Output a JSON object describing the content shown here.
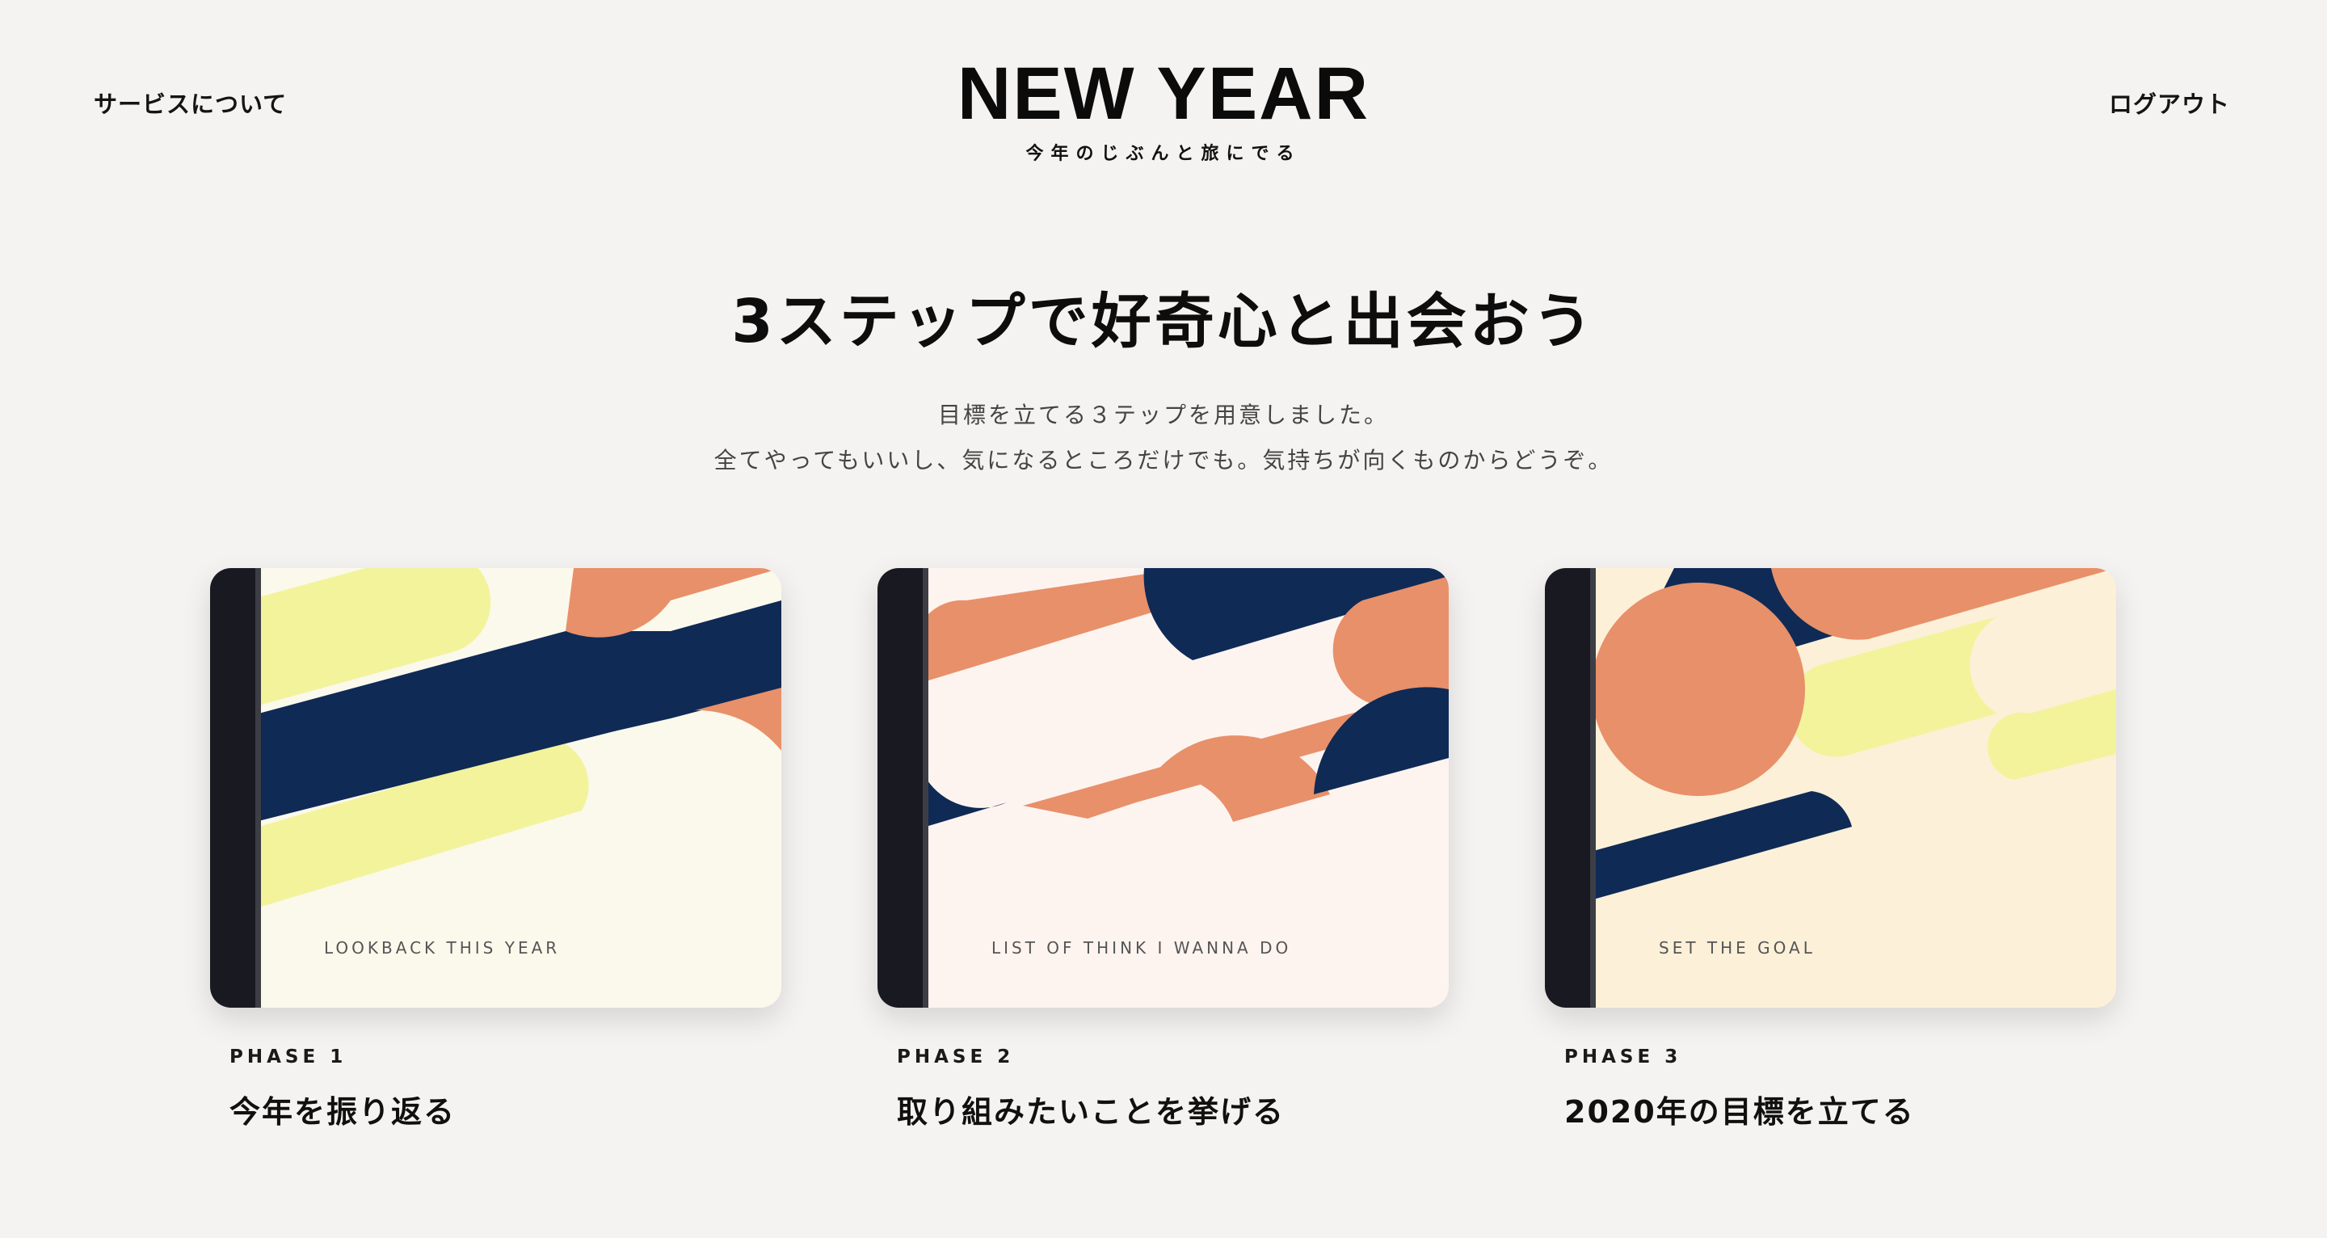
{
  "header": {
    "nav_left": "サービスについて",
    "logo_title": "NEW YEAR",
    "logo_subtitle": "今年のじぶんと旅にでる",
    "nav_right": "ログアウト"
  },
  "intro": {
    "headline": "3ステップで好奇心と出会おう",
    "description_line1": "目標を立てる３テップを用意しました。",
    "description_line2": "全てやってもいいし、気になるところだけでも。気持ちが向くものからどうぞ。"
  },
  "cards": [
    {
      "cover_label": "LOOKBACK THIS YEAR",
      "phase": "PHASE 1",
      "title": "今年を振り返る"
    },
    {
      "cover_label": "LIST OF THINK I WANNA DO",
      "phase": "PHASE 2",
      "title": "取り組みたいことを挙げる"
    },
    {
      "cover_label": "SET THE GOAL",
      "phase": "PHASE 3",
      "title": "2020年の目標を立てる"
    }
  ],
  "colors": {
    "background": "#f5f3f1",
    "navy": "#0f2a55",
    "orange": "#e8906a",
    "yellow": "#f3f39c",
    "spine": "#191a21"
  }
}
